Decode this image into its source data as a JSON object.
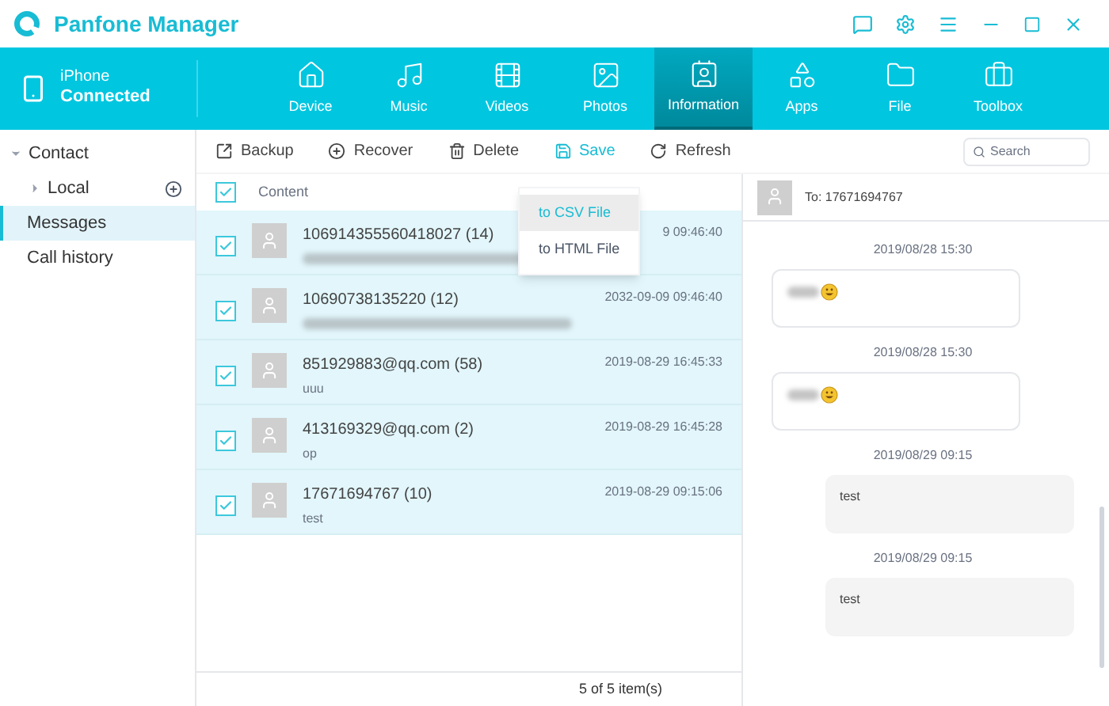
{
  "window": {
    "title": "Panfone Manager"
  },
  "device": {
    "name": "iPhone",
    "status": "Connected"
  },
  "tabs": [
    {
      "label": "Device",
      "selected": false
    },
    {
      "label": "Music",
      "selected": false
    },
    {
      "label": "Videos",
      "selected": false
    },
    {
      "label": "Photos",
      "selected": false
    },
    {
      "label": "Information",
      "selected": true
    },
    {
      "label": "Apps",
      "selected": false
    },
    {
      "label": "File",
      "selected": false
    },
    {
      "label": "Toolbox",
      "selected": false
    }
  ],
  "sidebar": {
    "items": [
      {
        "label": "Contact",
        "kind": "group",
        "expanded": true,
        "selected": false
      },
      {
        "label": "Local",
        "kind": "subgroup",
        "expanded": false,
        "selected": false
      },
      {
        "label": "Messages",
        "kind": "item",
        "selected": true
      },
      {
        "label": "Call history",
        "kind": "item",
        "selected": false
      }
    ]
  },
  "toolbar": [
    {
      "label": "Backup",
      "selected": false
    },
    {
      "label": "Recover",
      "selected": false
    },
    {
      "label": "Delete",
      "selected": false
    },
    {
      "label": "Save",
      "selected": true
    },
    {
      "label": "Refresh",
      "selected": false
    }
  ],
  "search": {
    "placeholder": "Search"
  },
  "save_menu": {
    "items": [
      {
        "label": "to CSV File",
        "selected": true
      },
      {
        "label": "to HTML File",
        "selected": false
      }
    ]
  },
  "list": {
    "header": {
      "label": "Content",
      "checked": true
    },
    "rows": [
      {
        "title": "106914355560418027 (14)",
        "date": "9 09:46:40",
        "kind": "redacted",
        "checked": true
      },
      {
        "title": "10690738135220 (12)",
        "date": "2032-09-09 09:46:40",
        "kind": "redacted",
        "checked": true
      },
      {
        "title": "851929883@qq.com (58)",
        "date": "2019-08-29 16:45:33",
        "kind": "text",
        "preview": "uuu",
        "checked": true
      },
      {
        "title": "413169329@qq.com (2)",
        "date": "2019-08-29 16:45:28",
        "kind": "text",
        "preview": "op",
        "checked": true
      },
      {
        "title": "17671694767 (10)",
        "date": "2019-08-29 09:15:06",
        "kind": "text",
        "preview": "test",
        "checked": true
      }
    ],
    "footer": "5 of 5 item(s)"
  },
  "conversation": {
    "to": "To: 17671694767",
    "messages": [
      {
        "time": "2019/08/28 15:30",
        "kind": "received",
        "redacted": true,
        "emoji": true
      },
      {
        "time": "2019/08/28 15:30",
        "kind": "received",
        "redacted": true,
        "emoji": true
      },
      {
        "time": "2019/08/29 09:15",
        "kind": "sent",
        "text": "test"
      },
      {
        "time": "2019/08/29 09:15",
        "kind": "sent",
        "text": "test"
      }
    ]
  }
}
